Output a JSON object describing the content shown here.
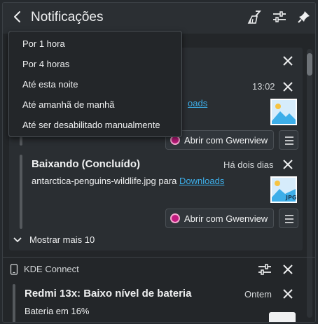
{
  "header": {
    "title": "Notificações",
    "icons": [
      "back-arrow-icon",
      "clear-broom-icon",
      "configure-sliders-icon",
      "pin-icon"
    ]
  },
  "dropdown": {
    "items": [
      "Por 1 hora",
      "Por 4 horas",
      "Até esta noite",
      "Até amanhã de manhã",
      "Até ser desabilitado manualmente"
    ]
  },
  "notifications": [
    {
      "time": "13:02",
      "link_fragment": "oads"
    },
    {
      "title": "Baixando (Concluído)",
      "time": "Há dois dias",
      "body_prefix": "antarctica-penguins-wildlife.jpg para ",
      "link": "Downloads",
      "thumb_label": "JPG"
    }
  ],
  "actions": {
    "open_with": "Abrir com Gwenview"
  },
  "show_more": "Mostrar mais 10",
  "kde_connect": {
    "app_name": "KDE Connect",
    "title": "Redmi 13x: Baixo nível de bateria",
    "time": "Ontem",
    "body": "Bateria em 16%"
  },
  "colors": {
    "accent": "#3daee9",
    "panel": "#2b2f33",
    "card": "#2a2e32",
    "gwenview": "#c21a7f"
  }
}
